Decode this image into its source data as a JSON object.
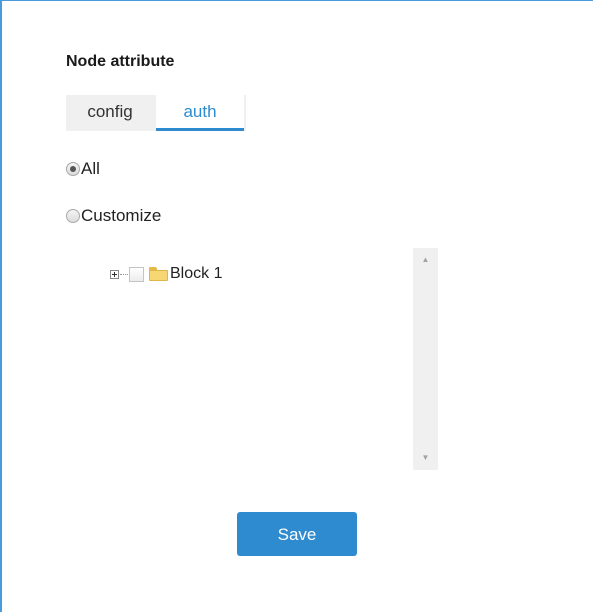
{
  "panel": {
    "title": "Node attribute"
  },
  "tabs": [
    {
      "label": "config",
      "active": false
    },
    {
      "label": "auth",
      "active": true
    }
  ],
  "scope": {
    "options": [
      {
        "label": "All",
        "checked": true
      },
      {
        "label": "Customize",
        "checked": false
      }
    ]
  },
  "tree": {
    "nodes": [
      {
        "label": "Block 1",
        "expanded": false,
        "checked": false,
        "icon": "folder-icon"
      }
    ]
  },
  "scrollbar": {
    "up_glyph": "▲",
    "down_glyph": "▼"
  },
  "actions": {
    "save_label": "Save"
  },
  "colors": {
    "accent": "#2e8bd0",
    "border": "#4a9bdc",
    "tab_bar_bg": "#f0f0f0",
    "folder": "#f7d774"
  }
}
